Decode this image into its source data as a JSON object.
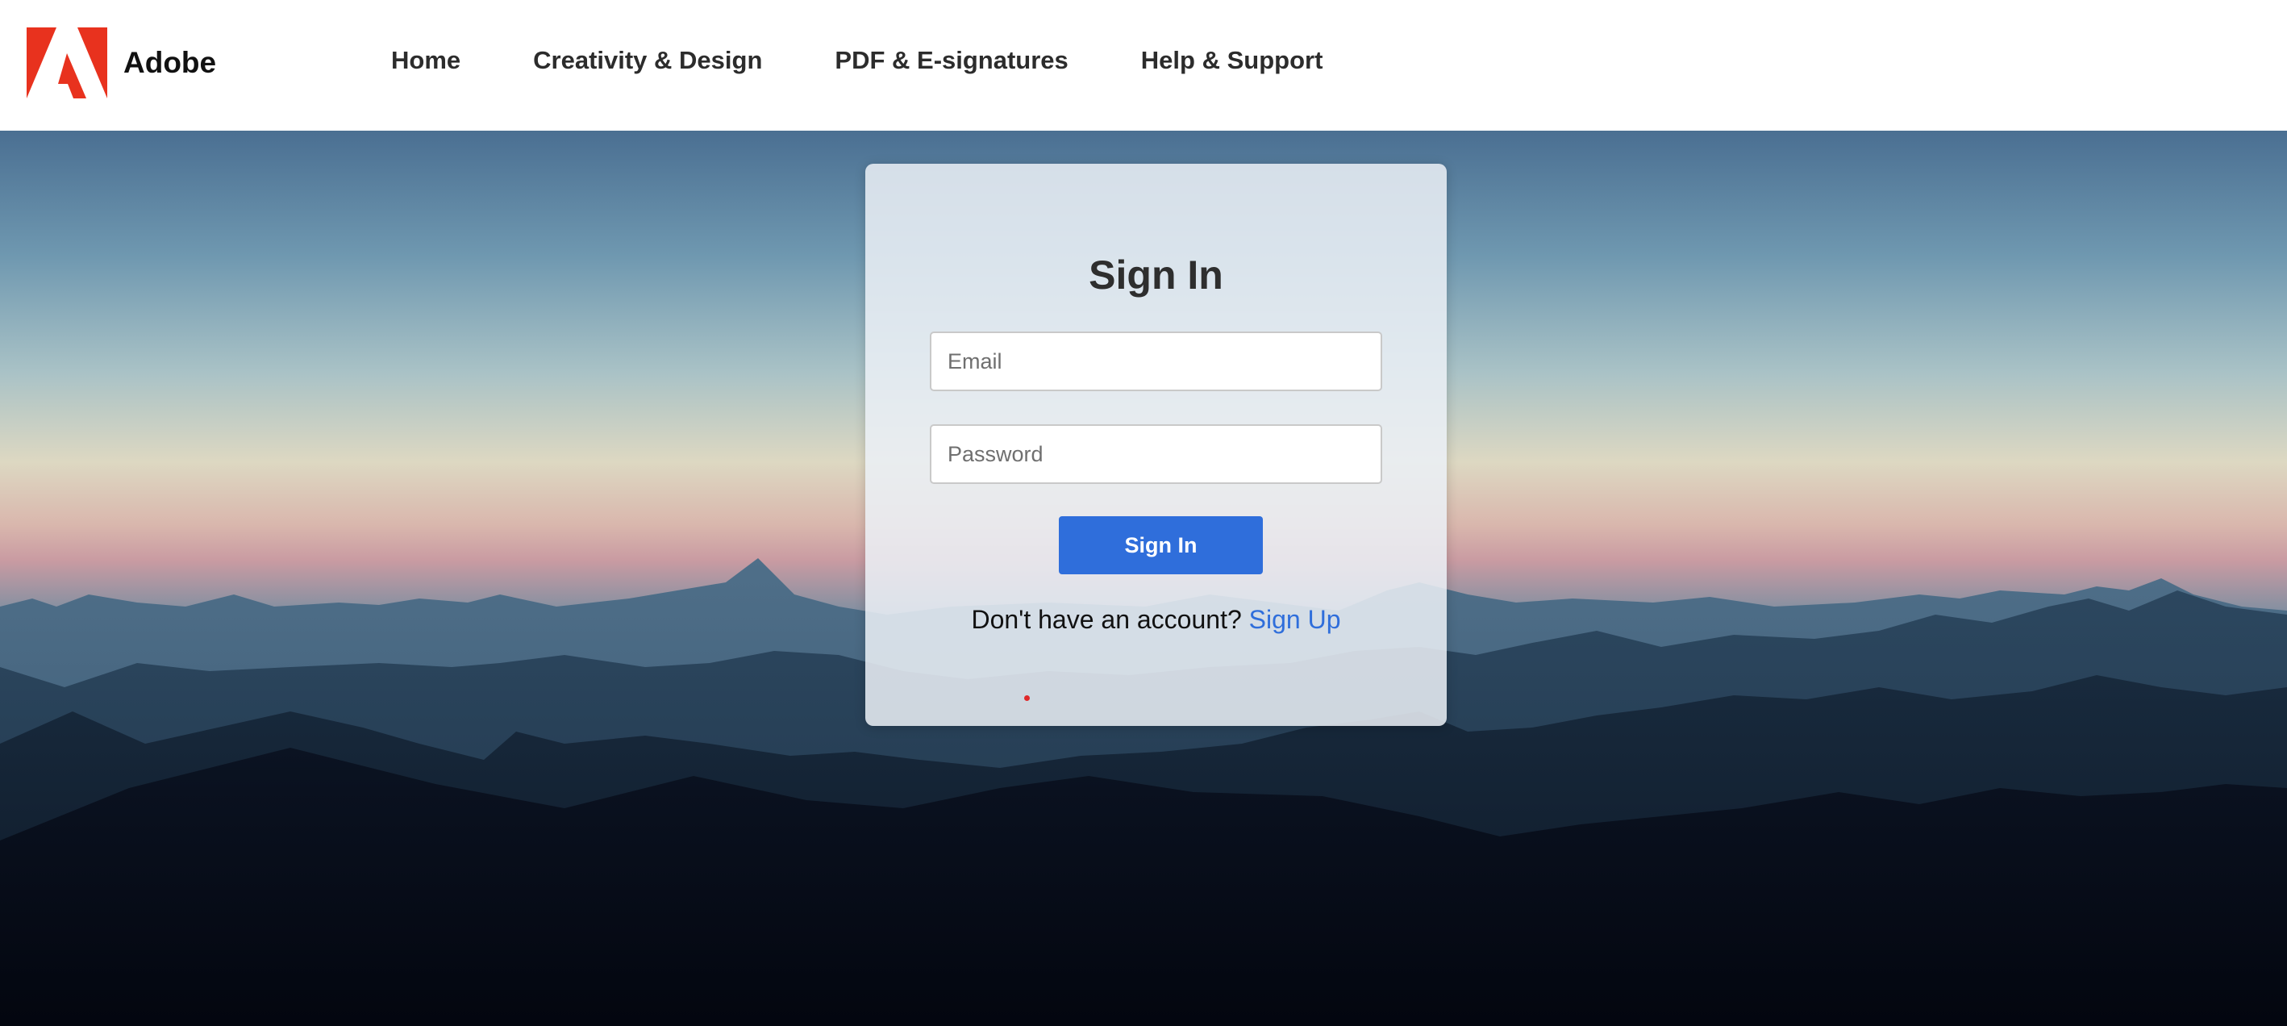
{
  "header": {
    "brand_name": "Adobe",
    "logo_icon": "adobe-logo-icon",
    "brand_color": "#e8321e",
    "nav": [
      {
        "label": "Home"
      },
      {
        "label": "Creativity & Design"
      },
      {
        "label": "PDF & E-signatures"
      },
      {
        "label": "Help & Support"
      }
    ]
  },
  "signin": {
    "title": "Sign In",
    "email_placeholder": "Email",
    "email_value": "",
    "password_placeholder": "Password",
    "password_value": "",
    "submit_label": "Sign In",
    "signup_prompt": "Don't have an account?",
    "signup_link": "Sign Up",
    "accent_color": "#2f6edb",
    "status_indicator_color": "#e0282a"
  },
  "background": {
    "scene": "mountain-silhouette-dusk-background"
  }
}
